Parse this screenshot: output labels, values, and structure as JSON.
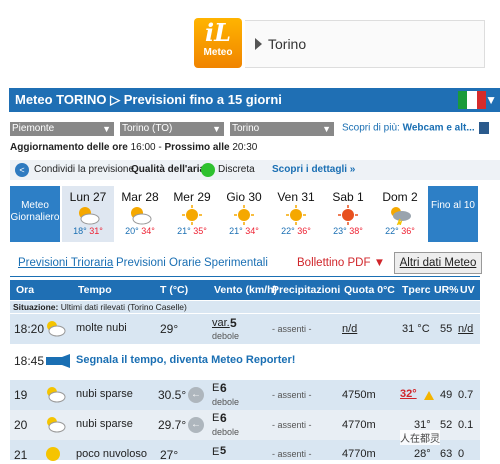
{
  "logo": {
    "word1": "iL",
    "word2": "Meteo"
  },
  "city": "Torino",
  "header": {
    "title": "Meteo TORINO ▷ Previsioni fino a 15 giorni",
    "dropdown": "▼",
    "flag_colors": [
      "#1a9a3a",
      "#ffffff",
      "#d52b2b"
    ]
  },
  "selects": [
    {
      "value": "Piemonte"
    },
    {
      "value": "Torino (TO)"
    },
    {
      "value": "Torino"
    }
  ],
  "scopri": {
    "label": "Scopri di più:",
    "link": "Webcam e alt..."
  },
  "aggiornamento": {
    "label": "Aggiornamento delle ore",
    "time": "16:00",
    "next_label": "Prossimo alle",
    "next_time": "20:30"
  },
  "sharebar": {
    "share": "Condividi la previsione",
    "air": "Qualità dell'aria",
    "air_status": "Discreta",
    "details": "Scopri i dettagli »",
    "air_color": "#2ec12e"
  },
  "daystrip": {
    "meteo_label": "Meteo Giornaliero",
    "fino_label": "Fino al 10",
    "days": [
      {
        "name": "Lun 27",
        "min": "18°",
        "max": "31°",
        "icon": "partly-cloudy-icon"
      },
      {
        "name": "Mar 28",
        "min": "20°",
        "max": "34°",
        "icon": "partly-cloudy-icon"
      },
      {
        "name": "Mer 29",
        "min": "21°",
        "max": "35°",
        "icon": "sun-icon"
      },
      {
        "name": "Gio 30",
        "min": "21°",
        "max": "34°",
        "icon": "sun-icon"
      },
      {
        "name": "Ven 31",
        "min": "22°",
        "max": "36°",
        "icon": "sun-icon"
      },
      {
        "name": "Sab 1",
        "min": "23°",
        "max": "38°",
        "icon": "hot-sun-icon"
      },
      {
        "name": "Dom 2",
        "min": "22°",
        "max": "36°",
        "icon": "storm-icon"
      }
    ]
  },
  "tabs": {
    "t1": "Previsioni Trioraria",
    "t2": "Previsioni Orarie",
    "t3": "Sperimentali",
    "bollettino": "Bollettino PDF ▼",
    "altri": "Altri dati Meteo"
  },
  "table": {
    "headers": {
      "ora": "Ora",
      "tempo": "Tempo",
      "temp": "T (°C)",
      "vento": "Vento (km/h)",
      "prec": "Precipitazioni",
      "quota": "Quota 0°C",
      "tperc": "Tperc",
      "ur": "UR%",
      "uv": "UV"
    },
    "situazione": {
      "label": "Situazione:",
      "text": "Ultimi dati rilevati (Torino Caselle)"
    },
    "rows": [
      {
        "ora": "18:20",
        "tempo": "molte nubi",
        "temp": "29°",
        "vento": "var.",
        "vento_val": "5",
        "vento_desc": "debole",
        "prec": "- assenti -",
        "quota": "n/d",
        "tperc": "31 °C",
        "ur": "55",
        "uv": "n/d"
      },
      {
        "ora": "18:45",
        "tempo": "Segnala il tempo, diventa Meteo Reporter!"
      },
      {
        "ora": "19",
        "tempo": "nubi sparse",
        "temp": "30.5°",
        "vento": "E",
        "vento_val": "6",
        "vento_desc": "debole",
        "prec": "- assenti -",
        "quota": "4750m",
        "tperc": "32°",
        "ur": "49",
        "uv": "0.7"
      },
      {
        "ora": "20",
        "tempo": "nubi sparse",
        "temp": "29.7°",
        "vento": "E",
        "vento_val": "6",
        "vento_desc": "debole",
        "prec": "- assenti -",
        "quota": "4770m",
        "tperc": "31°",
        "ur": "52",
        "uv": "0.1"
      },
      {
        "ora": "21",
        "tempo": "poco nuvoloso",
        "temp": "27°",
        "vento": "E",
        "vento_val": "5",
        "prec": "- assenti -",
        "quota": "4770m",
        "tperc": "28°",
        "ur": "63",
        "uv": "0"
      }
    ]
  },
  "watermark": "人在都灵"
}
